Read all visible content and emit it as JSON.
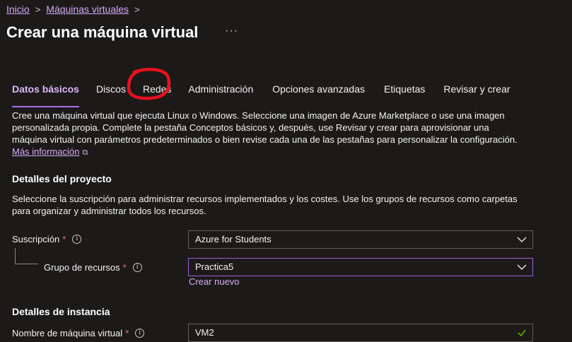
{
  "breadcrumb": {
    "items": [
      "Inicio",
      "Máquinas virtuales"
    ],
    "separator": ">"
  },
  "page": {
    "title": "Crear una máquina virtual",
    "more": "···"
  },
  "tabs": [
    {
      "label": "Datos básicos",
      "active": true
    },
    {
      "label": "Discos"
    },
    {
      "label": "Redes"
    },
    {
      "label": "Administración"
    },
    {
      "label": "Opciones avanzadas"
    },
    {
      "label": "Etiquetas"
    },
    {
      "label": "Revisar y crear"
    }
  ],
  "intro": {
    "text": "Cree una máquina virtual que ejecuta Linux o Windows. Seleccione una imagen de Azure Marketplace o use una imagen personalizada propia. Complete la pestaña Conceptos básicos y, después, use Revisar y crear para aprovisionar una máquina virtual con parámetros predeterminados o bien revise cada una de las pestañas para personalizar la configuración.",
    "link": "Más información"
  },
  "project": {
    "heading": "Detalles del proyecto",
    "text": "Seleccione la suscripción para administrar recursos implementados y los costes. Use los grupos de recursos como carpetas para organizar y administrar todos los recursos.",
    "subscription": {
      "label": "Suscripción",
      "required": "*",
      "value": "Azure for Students"
    },
    "resource_group": {
      "label": "Grupo de recursos",
      "required": "*",
      "value": "Practica5",
      "create_new": "Crear nuevo"
    }
  },
  "instance": {
    "heading": "Detalles de instancia",
    "vm_name": {
      "label": "Nombre de máquina virtual",
      "required": "*",
      "value": "VM2"
    }
  },
  "icons": {
    "info": "info-icon",
    "chevron": "chevron-down-icon",
    "external": "external-link-icon",
    "breadcrumb_sep": "chevron-right-icon"
  },
  "colors": {
    "accent": "#b16ee8",
    "link": "#d7a9f5",
    "required": "#f1707b",
    "annotation": "#e8101e",
    "background": "#1b1a19"
  }
}
